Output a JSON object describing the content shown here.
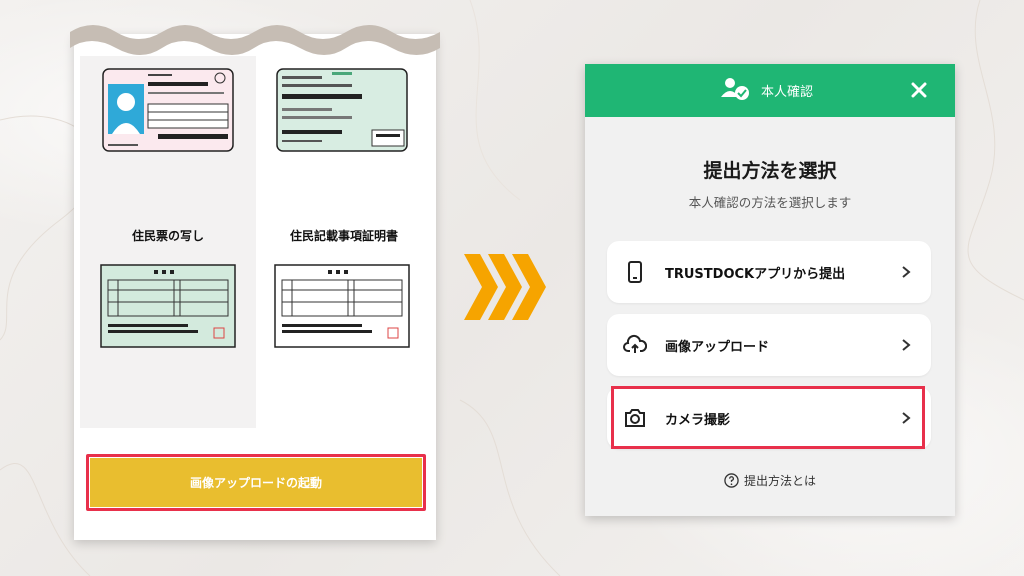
{
  "left_panel": {
    "documents": [
      {
        "label": ""
      },
      {
        "label": ""
      },
      {
        "label": "住民票の写し"
      },
      {
        "label": "住民記載事項証明書"
      }
    ],
    "launch_button": "画像アップロードの起動"
  },
  "right_panel": {
    "header_title": "本人確認",
    "title": "提出方法を選択",
    "subtitle": "本人確認の方法を選択します",
    "options": [
      {
        "label": "TRUSTDOCKアプリから提出",
        "icon": "smartphone-icon"
      },
      {
        "label": "画像アップロード",
        "icon": "cloud-upload-icon"
      },
      {
        "label": "カメラ撮影",
        "icon": "camera-icon"
      }
    ],
    "help_link": "提出方法とは"
  },
  "colors": {
    "green": "#1fb674",
    "yellow": "#e9be2f",
    "highlight": "#e8304b",
    "arrow": "#f6a400"
  }
}
